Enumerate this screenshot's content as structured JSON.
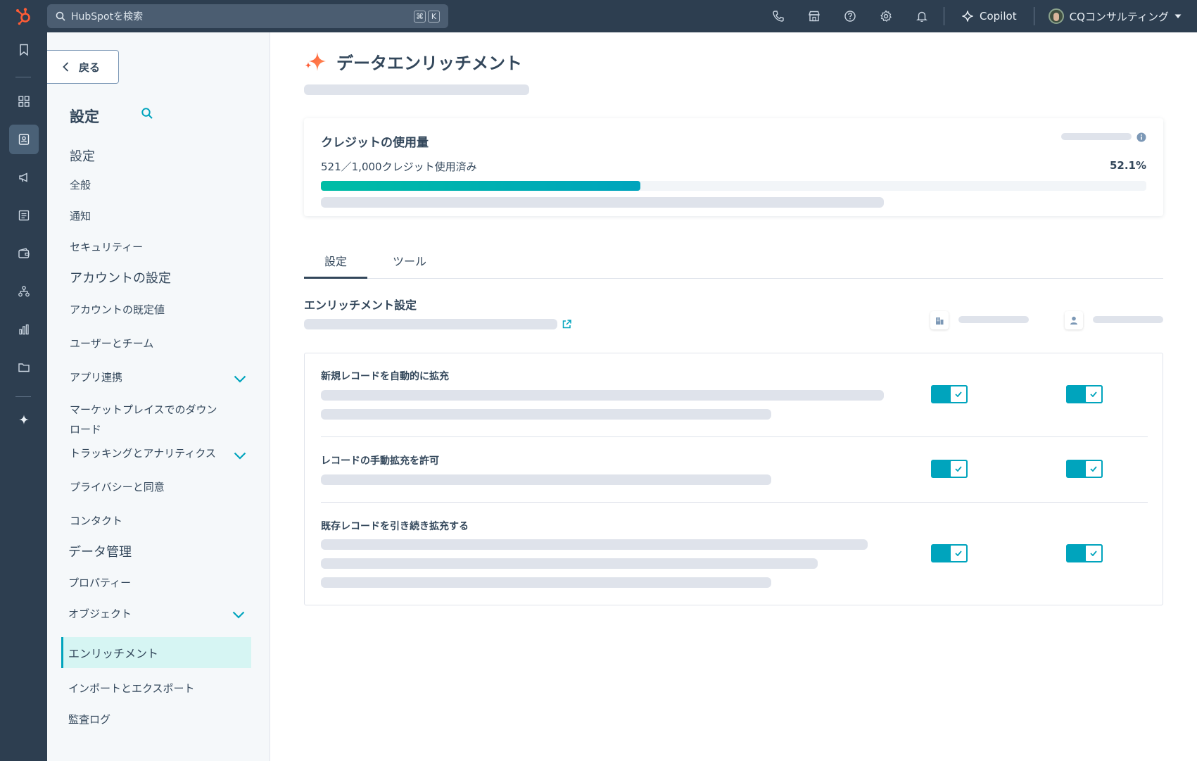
{
  "colors": {
    "nav_bg": "#2d3e50",
    "accent": "#00a4bd",
    "brand_orange": "#ff5c35",
    "text": "#33475b",
    "skeleton": "#dfe3eb",
    "active_bg": "#d6f5f3"
  },
  "topbar": {
    "search_placeholder": "HubSpotを検索",
    "shortcut_keys": [
      "⌘",
      "K"
    ],
    "copilot_label": "Copilot",
    "account_name": "CQコンサルティング"
  },
  "rail": {
    "icons": [
      "bookmark-icon",
      "grid-icon",
      "contacts-icon",
      "megaphone-icon",
      "document-icon",
      "wallet-icon",
      "network-icon",
      "reports-icon",
      "folder-icon",
      "sparkle-icon"
    ]
  },
  "sidebar": {
    "back_label": "戻る",
    "title": "設定",
    "sections": {
      "settings_heading": "設定",
      "general": "全般",
      "notifications": "通知",
      "security": "セキュリティー",
      "account_heading": "アカウントの設定",
      "account_defaults": "アカウントの既定値",
      "users_teams": "ユーザーとチーム",
      "integrations": "アプリ連携",
      "marketplace": "マーケットプレイスでのダウンロード",
      "tracking": "トラッキングとアナリティクス",
      "privacy": "プライバシーと同意",
      "contacts": "コンタクト",
      "data_heading": "データ管理",
      "properties": "プロパティー",
      "objects": "オブジェクト",
      "enrichment": "エンリッチメント",
      "import_export": "インポートとエクスポート",
      "audit_log": "監査ログ"
    }
  },
  "main": {
    "title": "データエンリッチメント",
    "credits_card": {
      "title": "クレジットの使用量",
      "usage_text": "521／1,000クレジット使用済み",
      "percent_text": "52.1%",
      "used": 521,
      "total": 1000,
      "fraction": 0.387
    },
    "tabs": [
      "設定",
      "ツール"
    ],
    "active_tab": 0,
    "section_title": "エンリッチメント設定",
    "rows": [
      {
        "label": "新規レコードを自動的に拡充",
        "company_on": true,
        "contact_on": true
      },
      {
        "label": "レコードの手動拡充を許可",
        "company_on": true,
        "contact_on": true
      },
      {
        "label": "既存レコードを引き続き拡充する",
        "company_on": true,
        "contact_on": true
      }
    ]
  }
}
